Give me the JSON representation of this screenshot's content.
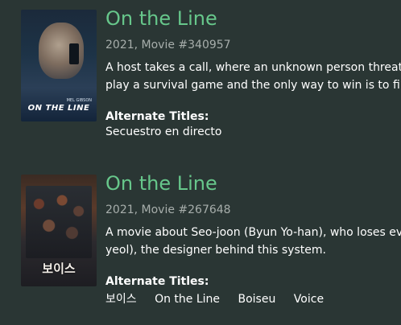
{
  "results": [
    {
      "title": "On the Line",
      "meta": "2021, Movie #340957",
      "description_lines": [
        "A host takes a call, where an unknown person threat",
        "play a survival game and the only way to win is to fin"
      ],
      "alt_heading": "Alternate Titles:",
      "alt_titles": [
        "Secuestro en directo"
      ],
      "poster": {
        "title_text": "ON THE LINE",
        "actor_text": "MEL GIBSON"
      }
    },
    {
      "title": "On the Line",
      "meta": "2021, Movie #267648",
      "description_lines": [
        "A movie about Seo-joon (Byun Yo-han), who loses eve",
        "yeol), the designer behind this system."
      ],
      "alt_heading": "Alternate Titles:",
      "alt_titles": [
        "보이스",
        "On the Line",
        "Boiseu",
        "Voice"
      ],
      "poster": {
        "title_text": "보이스"
      }
    }
  ]
}
